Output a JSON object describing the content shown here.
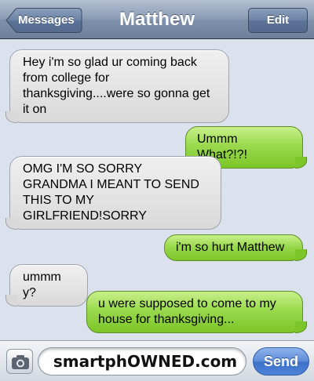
{
  "navbar": {
    "back_label": "Messages",
    "title": "Matthew",
    "edit_label": "Edit"
  },
  "messages": [
    {
      "from": "contact",
      "lines": [
        "Hey i'm so glad ur coming back",
        "from college for",
        "thanksgiving....were so gonna get",
        "it on"
      ]
    },
    {
      "from": "me",
      "lines": [
        "Ummm What?!?!"
      ]
    },
    {
      "from": "contact",
      "lines": [
        "OMG I'M SO SORRY",
        "GRANDMA I MEANT TO SEND",
        "THIS TO MY",
        "GIRLFRIEND!SORRY"
      ]
    },
    {
      "from": "me",
      "lines": [
        "i'm so hurt Matthew"
      ]
    },
    {
      "from": "contact",
      "lines": [
        "ummm y?"
      ]
    },
    {
      "from": "me",
      "lines": [
        "u were supposed to come to my",
        "house for thanksgiving..."
      ]
    }
  ],
  "composer": {
    "field_text": "smartphOWNED.com",
    "send_label": "Send"
  },
  "colors": {
    "incoming_bubble": "#e4e4e4",
    "outgoing_bubble": "#9ad94e",
    "background": "#dbe2ed",
    "navbar": "#8b9cb5",
    "send_button": "#4c82d8"
  },
  "icons": {
    "back": "chevron-left-button",
    "camera": "camera-icon"
  }
}
